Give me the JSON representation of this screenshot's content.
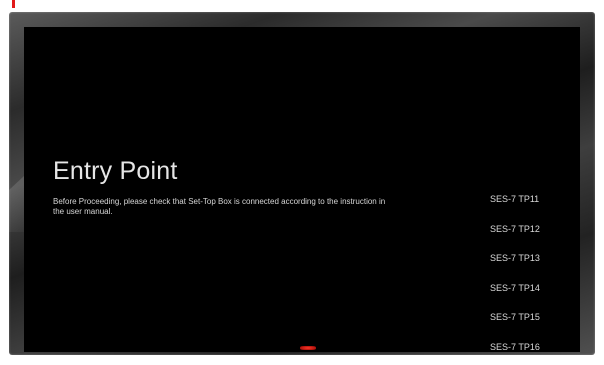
{
  "colors": {
    "screen_background": "#000000",
    "text_primary": "#e6e6e6",
    "indicator_red": "#e11a1a"
  },
  "entry_point": {
    "title": "Entry Point",
    "description": "Before Proceeding, please check that Set-Top Box is connected according to the instruction in the user manual."
  },
  "transponders": [
    {
      "label": "SES-7 TP11"
    },
    {
      "label": "SES-7 TP12"
    },
    {
      "label": "SES-7 TP13"
    },
    {
      "label": "SES-7 TP14"
    },
    {
      "label": "SES-7 TP15"
    },
    {
      "label": "SES-7 TP16"
    }
  ]
}
